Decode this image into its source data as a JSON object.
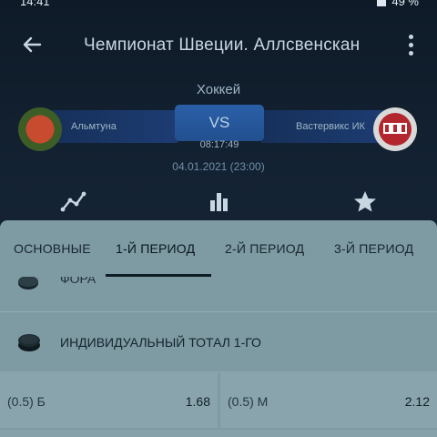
{
  "status_bar": {
    "time": "14:41",
    "battery": "49 %"
  },
  "header": {
    "title": "Чемпионат Швеции. Аллсвенскан"
  },
  "match": {
    "sport": "Хоккей",
    "home_team": "Альмтуна",
    "away_team": "Вастервикс ИК",
    "vs": "VS",
    "countdown": "08:17:49",
    "datetime": "04.01.2021 (23:00)"
  },
  "tabs": [
    {
      "label": "ОСНОВНЫЕ"
    },
    {
      "label": "1-Й ПЕРИОД"
    },
    {
      "label": "2-Й ПЕРИОД"
    },
    {
      "label": "3-Й ПЕРИОД"
    }
  ],
  "sections": [
    {
      "label": "ФОРА"
    },
    {
      "label": "ИНДИВИДУАЛЬНЫЙ ТОТАЛ 1-ГО"
    }
  ],
  "odds": [
    {
      "label": "(0.5) Б",
      "value": "1.68"
    },
    {
      "label": "(0.5) М",
      "value": "2.12"
    }
  ],
  "colors": {
    "accent": "#22508f",
    "sheet": "#7e9aa3"
  }
}
